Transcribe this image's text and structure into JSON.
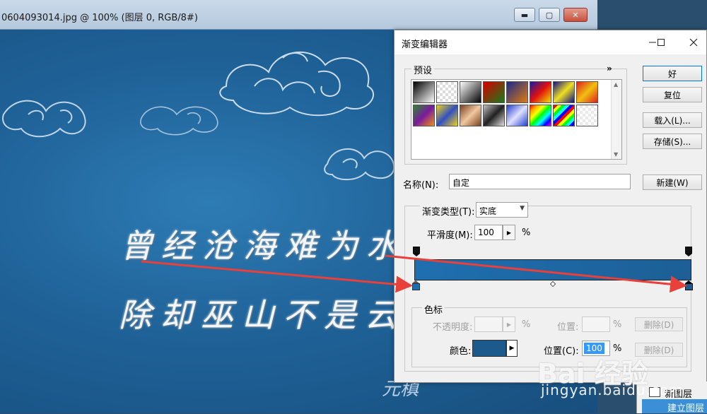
{
  "document_window": {
    "title": "0604093014.jpg @ 100% (图层 0, RGB/8#)",
    "minimize_glyph": "▬",
    "maximize_glyph": "▢",
    "close_glyph": "✕",
    "canvas": {
      "poem_line_1": "曾经沧海难为水",
      "poem_line_2": "除却巫山不是云",
      "signature": "元稹"
    }
  },
  "gradient_editor": {
    "title": "渐变编辑器",
    "presets_legend": "预设",
    "presets_menu": "»",
    "buttons": {
      "ok": "好",
      "reset": "复位",
      "load": "载入(L)...",
      "save": "存储(S)...",
      "new": "新建(W)"
    },
    "name_label": "名称(N):",
    "name_value": "自定",
    "gradient_type_label": "渐变类型(T):",
    "gradient_type_value": "实底",
    "smoothness_label": "平滑度(M):",
    "smoothness_value": "100",
    "smoothness_unit": "%",
    "stops": {
      "legend": "色标",
      "opacity_label": "不透明度:",
      "opacity_unit": "%",
      "opacity_position_label": "位置:",
      "opacity_position_unit": "%",
      "opacity_delete": "删除(D)",
      "color_label": "颜色:",
      "color_value": "#1d5a8c",
      "color_position_label": "位置(C):",
      "color_position_value": "100",
      "color_position_unit": "%",
      "color_delete": "删除(D)"
    },
    "gradient_colors": {
      "start": "#1f6fb0",
      "end": "#1d5f96"
    }
  },
  "layers_panel": {
    "new_layer": "新图层",
    "build_layer": "建立图层"
  },
  "watermark": {
    "logo": "Bai 经验",
    "url": "jingyan.baidu.com"
  },
  "annotation": {
    "arrow_color": "#e8403a"
  }
}
